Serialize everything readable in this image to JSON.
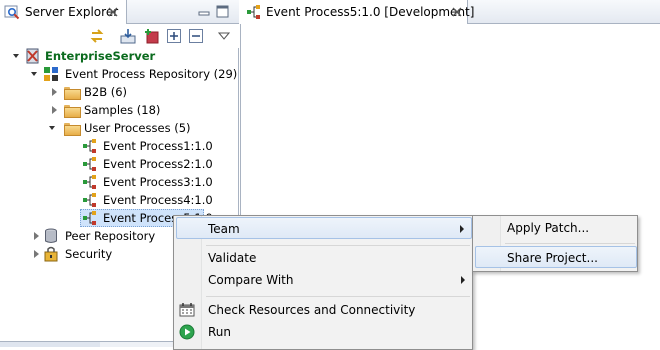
{
  "left_panel": {
    "tab_title": "Server Explorer",
    "tree": {
      "server": "EnterpriseServer",
      "repository": "Event Process Repository (29)",
      "folders": [
        "B2B (6)",
        "Samples (18)",
        "User Processes (5)"
      ],
      "processes": [
        "Event Process1:1.0",
        "Event Process2:1.0",
        "Event Process3:1.0",
        "Event Process4:1.0",
        "Event Process5:1.0"
      ],
      "peer_repository": "Peer Repository",
      "security": "Security"
    }
  },
  "editor": {
    "tab_title": "Event Process5:1.0 [Development]"
  },
  "context_menu": {
    "items": [
      "Team",
      "Validate",
      "Compare With",
      "Check Resources and Connectivity",
      "Run"
    ]
  },
  "submenu": {
    "items": [
      "Apply Patch...",
      "Share Project..."
    ]
  },
  "colors": {
    "server_label": "#0b6b1e",
    "selection_bg": "#cfe3fb",
    "highlight_border": "#a6c2e6"
  },
  "icons": [
    "server-explorer-icon",
    "close-icon",
    "minimize-icon",
    "maximize-icon",
    "sync-icon",
    "import-icon",
    "new-project-icon",
    "expand-all-icon",
    "collapse-all-icon",
    "view-menu-icon",
    "enterprise-server-icon",
    "repository-icon",
    "folder-icon",
    "event-process-icon",
    "peer-repository-icon",
    "security-icon",
    "check-resources-icon",
    "run-icon"
  ]
}
